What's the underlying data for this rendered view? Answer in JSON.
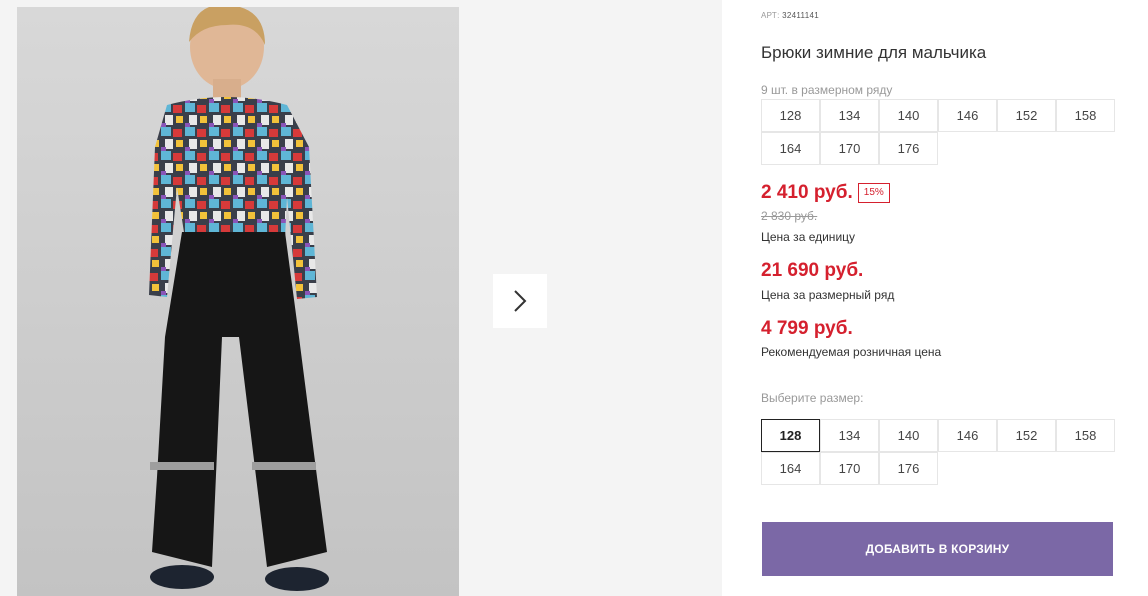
{
  "product": {
    "sku_label": "АРТ:",
    "sku_value": "32411141",
    "title": "Брюки зимние для мальчика"
  },
  "size_range": {
    "note": "9 шт. в размерном ряду",
    "sizes": [
      "128",
      "134",
      "140",
      "146",
      "152",
      "158",
      "164",
      "170",
      "176"
    ]
  },
  "pricing": {
    "unit_price": "2 410 руб.",
    "discount_badge": "15%",
    "old_price": "2 830 руб.",
    "unit_caption": "Цена за единицу",
    "range_price": "21 690 руб.",
    "range_caption": "Цена за размерный ряд",
    "retail_price": "4 799 руб.",
    "retail_caption": "Рекомендуемая розничная цена"
  },
  "size_select": {
    "label": "Выберите размер:",
    "sizes": [
      "128",
      "134",
      "140",
      "146",
      "152",
      "158",
      "164",
      "170",
      "176"
    ],
    "selected": "128"
  },
  "cart": {
    "button_label": "ДОБАВИТЬ В КОРЗИНУ"
  },
  "gallery": {
    "next_icon": "chevron-right-icon"
  },
  "colors": {
    "accent": "#7b68a6",
    "price_red": "#d5202e"
  }
}
